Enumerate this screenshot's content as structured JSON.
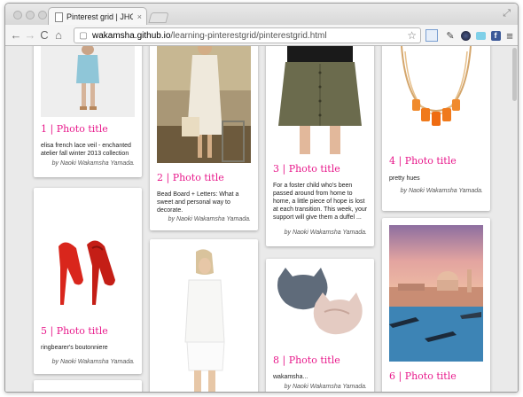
{
  "browser": {
    "tab_title": "Pinterest grid | JHC Study",
    "tab_close": "×",
    "url_host": "wakamsha.github.io",
    "url_path": "/learning-pinterestgrid/pinterestgrid.html",
    "nav_back": "←",
    "nav_forward": "→",
    "nav_reload": "C",
    "nav_home": "⌂",
    "star": "☆",
    "menu": "≡"
  },
  "colors": {
    "title_accent": "#e8198b",
    "page_bg": "#eaeaea"
  },
  "cards": [
    {
      "title": "1 | Photo title",
      "desc": "elisa french lace veil - enchanted atelier fall winter 2013 collection",
      "author": "by Naoki Wakamsha Yamada."
    },
    {
      "title": "2 | Photo title",
      "desc": "Bead Board + Letters: What a sweet and personal way to decorate.",
      "author": "by Naoki Wakamsha Yamada."
    },
    {
      "title": "3 | Photo title",
      "desc": "For a foster child who's been passed around from home to home, a little piece of hope is lost at each transition. This week, your support will give them a duffel ...",
      "author": "by Naoki Wakamsha Yamada."
    },
    {
      "title": "4 | Photo title",
      "desc": "pretty hues",
      "author": "by Naoki Wakamsha Yamada."
    },
    {
      "title": "5 | Photo title",
      "desc": "ringbearer's boutonniere",
      "author": "by Naoki Wakamsha Yamada."
    },
    {
      "title": "8 | Photo title",
      "desc": "wakamsha...",
      "author": "by Naoki Wakamsha Yamada."
    },
    {
      "title": "6 | Photo title"
    }
  ]
}
